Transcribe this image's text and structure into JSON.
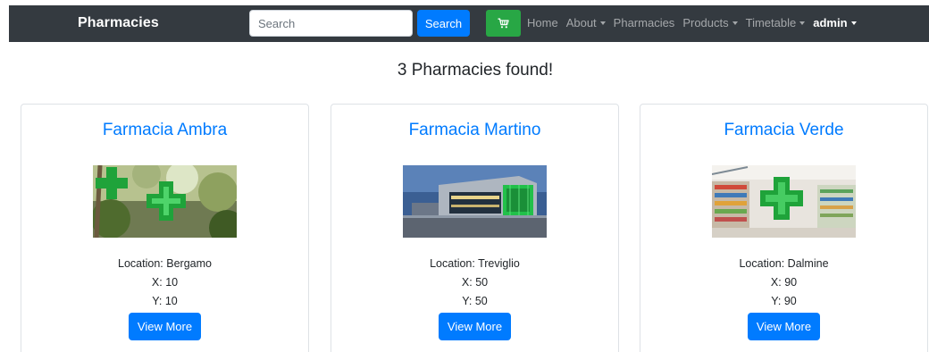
{
  "navbar": {
    "brand": "Pharmacies",
    "search": {
      "placeholder": "Search",
      "button_label": "Search"
    },
    "cart_icon": "cart-icon",
    "links": {
      "home": "Home",
      "about": "About",
      "pharmacies": "Pharmacies",
      "products": "Products",
      "timetable": "Timetable",
      "user": "admin"
    }
  },
  "results": {
    "title": "3 Pharmacies found!"
  },
  "pharmacies": [
    {
      "name": "Farmacia Ambra",
      "location": "Location: Bergamo",
      "x": "X: 10",
      "y": "Y: 10",
      "button_label": "View More"
    },
    {
      "name": "Farmacia Martino",
      "location": "Location: Treviglio",
      "x": "X: 50",
      "y": "Y: 50",
      "button_label": "View More"
    },
    {
      "name": "Farmacia Verde",
      "location": "Location: Dalmine",
      "x": "X: 90",
      "y": "Y: 90",
      "button_label": "View More"
    }
  ],
  "colors": {
    "navbar_bg": "#343a40",
    "primary": "#007bff",
    "success": "#28a745",
    "pharmacy_green": "#1fa33a"
  }
}
